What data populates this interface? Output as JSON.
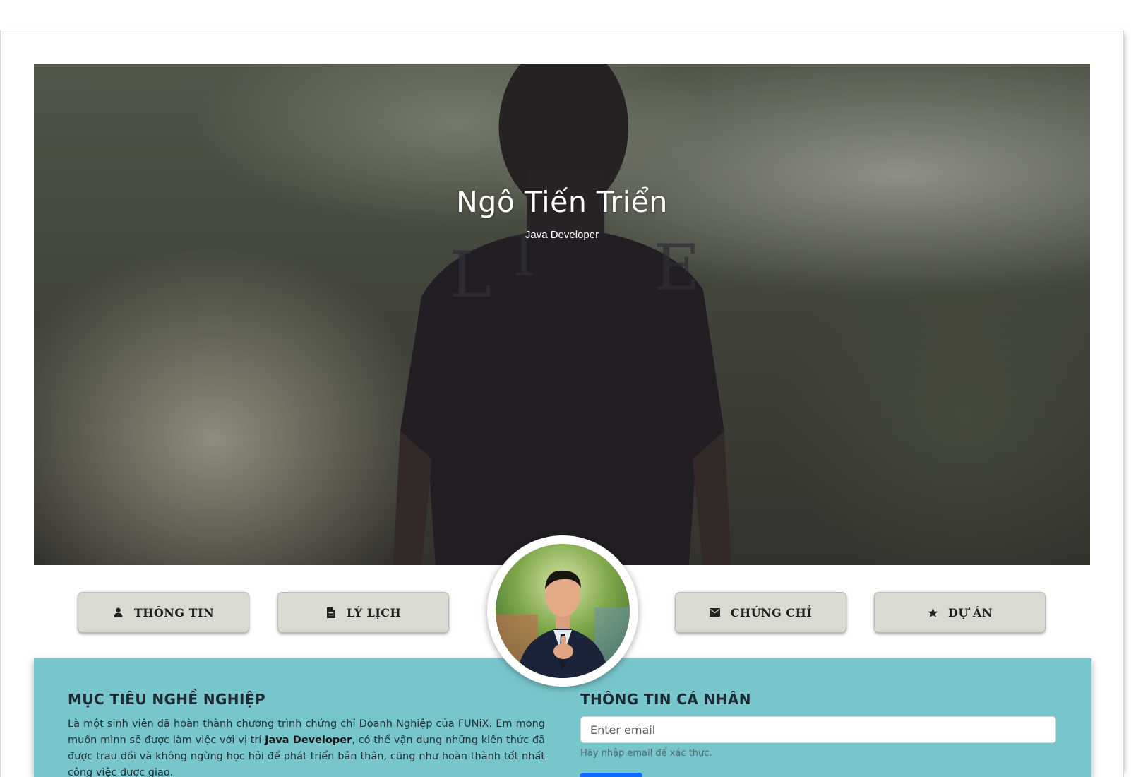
{
  "hero": {
    "name": "Ngô Tiến Triển",
    "subtitle": "Java Developer"
  },
  "nav": {
    "info": {
      "label": "THÔNG TIN",
      "icon": "user-icon"
    },
    "cv": {
      "label": "LÝ LỊCH",
      "icon": "document-icon"
    },
    "certificates": {
      "label": "CHỨNG CHỈ",
      "icon": "envelope-icon"
    },
    "projects": {
      "label": "DỰ ÁN",
      "icon": "star-icon"
    }
  },
  "career": {
    "title": "MỤC TIÊU NGHỀ NGHIỆP",
    "text_before": "Là một sinh viên đã hoàn thành chương trình chứng chỉ Doanh Nghiệp của FUNiX. Em mong muốn mình sẽ được làm việc với vị trí ",
    "text_bold": "Java Developer",
    "text_after": ", có thể vận dụng những kiến thức đã được trau dồi và không ngừng học hỏi để phát triển bản thân, cũng như hoàn thành tốt nhất công việc được giao."
  },
  "personal": {
    "title": "THÔNG TIN CÁ NHÂN",
    "email_placeholder": "Enter email",
    "email_help": "Hãy nhập email để xác thực."
  },
  "colors": {
    "panel": "#77c6cc",
    "nav_button": "#dadad3",
    "primary": "#0d6efd"
  }
}
